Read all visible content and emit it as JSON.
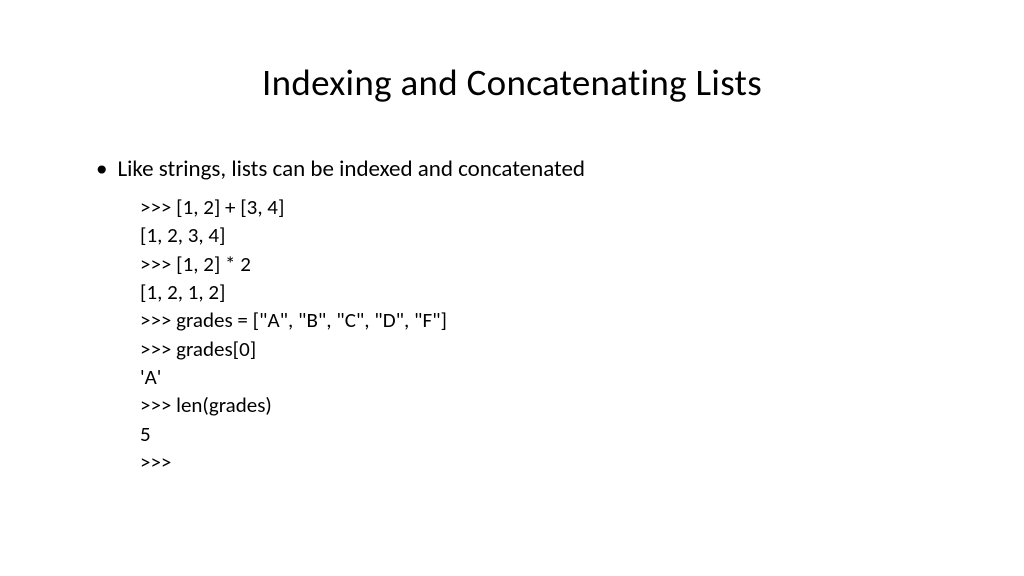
{
  "title": "Indexing and Concatenating Lists",
  "bullet": {
    "dot": "•",
    "text": "Like strings, lists can be indexed and concatenated"
  },
  "code": {
    "lines": [
      ">>> [1, 2] + [3, 4]",
      "[1, 2, 3, 4]",
      ">>> [1, 2] * 2",
      "[1, 2, 1, 2]",
      ">>> grades = [\"A\", \"B\", \"C\", \"D\", \"F\"]",
      ">>> grades[0]",
      "'A'",
      ">>> len(grades)",
      "5",
      ">>>"
    ]
  }
}
